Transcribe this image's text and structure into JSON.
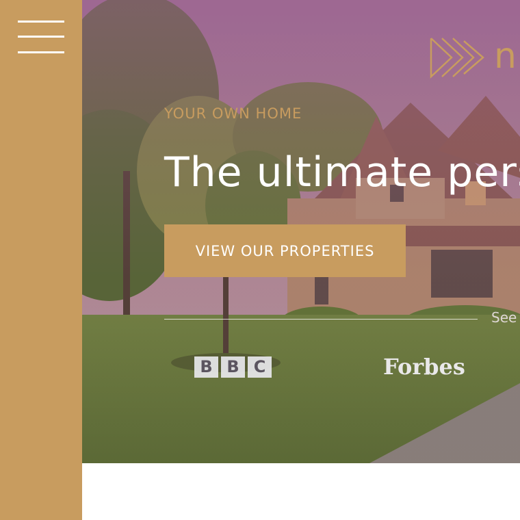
{
  "navigation": {
    "menu_icon": "hamburger-menu-icon"
  },
  "brand": {
    "mark_icon": "triple-chevron-logo-icon",
    "wordmark_partial": "n"
  },
  "hero": {
    "eyebrow": "YOUR OWN HOME",
    "headline": "The ultimate pers",
    "cta_label": "VIEW OUR PROPERTIES",
    "see_text": "See"
  },
  "press_logos": {
    "bbc_letters": [
      "B",
      "B",
      "C"
    ],
    "forbes": "Forbes"
  },
  "colors": {
    "accent_gold": "#c89c5f",
    "white": "#ffffff"
  }
}
